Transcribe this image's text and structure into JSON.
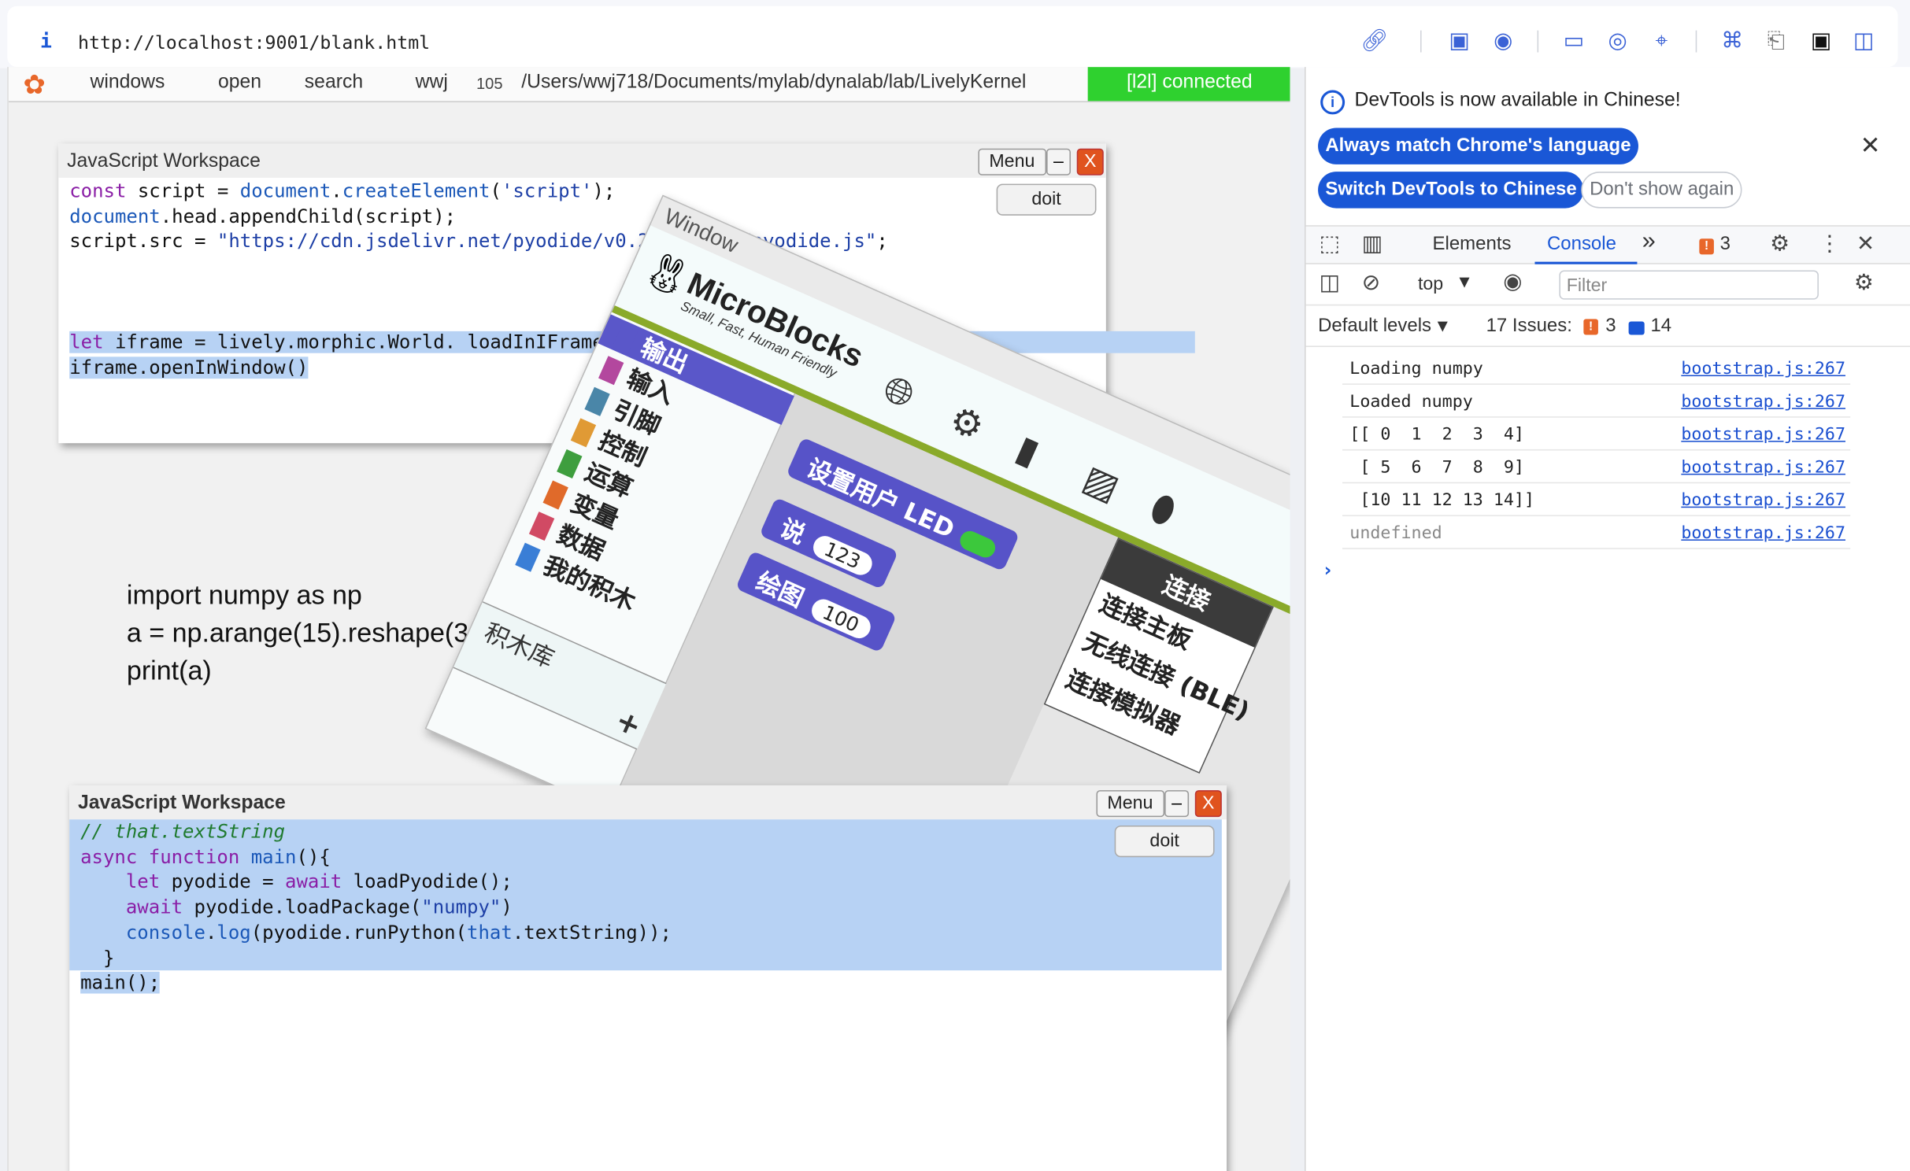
{
  "browser": {
    "info_glyph": "i",
    "url": "http://localhost:9001/blank.html",
    "toolbar_icons": [
      "link-icon",
      "screenshot-icon",
      "camera-icon",
      "terminal-icon",
      "globe-icon",
      "crosshair-icon",
      "extensions-icon",
      "h-icon",
      "square-icon",
      "sidebar-icon"
    ]
  },
  "lively": {
    "menu": [
      "windows",
      "open",
      "search",
      "wwj"
    ],
    "count": "105",
    "path": "/Users/wwj718/Documents/mylab/dynalab/lab/LivelyKernel",
    "status": "[l2l] connected",
    "python_text": "import numpy as np\na = np.arange(15).reshape(3, 5)\nprint(a)"
  },
  "workspace1": {
    "title": "JavaScript Workspace",
    "menu": "Menu",
    "min": "–",
    "close": "X",
    "doit": "doit"
  },
  "workspace2": {
    "title": "JavaScript Workspace",
    "menu": "Menu",
    "min": "–",
    "close": "X",
    "doit": "doit"
  },
  "microblocks": {
    "window_title": "Window",
    "title": "MicroBlocks",
    "subtitle": "Small, Fast, Human Friendly",
    "categories": [
      {
        "label": "输出",
        "color": "#5a57c9"
      },
      {
        "label": "输入",
        "color": "#b3479e"
      },
      {
        "label": "引脚",
        "color": "#4a86a8"
      },
      {
        "label": "控制",
        "color": "#e09a35"
      },
      {
        "label": "运算",
        "color": "#3e9e3e"
      },
      {
        "label": "变量",
        "color": "#e06a2a"
      },
      {
        "label": "数据",
        "color": "#d14a64"
      },
      {
        "label": "我的积木",
        "color": "#3a7ed6"
      }
    ],
    "library": "积木库",
    "add": "+",
    "blocks": {
      "led": "设置用户 LED",
      "say": "说",
      "say_val": "123",
      "graph": "绘图",
      "graph_val": "100"
    },
    "connect": {
      "header": "连接",
      "items": [
        "连接主板",
        "无线连接 (BLE)",
        "连接模拟器"
      ]
    }
  },
  "devtools": {
    "banner": "DevTools is now available in Chinese!",
    "btn_match": "Always match Chrome's language",
    "btn_switch": "Switch DevTools to Chinese",
    "btn_dont": "Don't show again",
    "tab_elements": "Elements",
    "tab_console": "Console",
    "more_tabs": "»",
    "warn_count": "3",
    "context": "top",
    "filter_placeholder": "Filter",
    "levels": "Default levels",
    "issues_label": "17 Issues:",
    "issues_warn": "3",
    "issues_info": "14",
    "logs": [
      {
        "msg": "Loading numpy",
        "src": "bootstrap.js:267"
      },
      {
        "msg": "Loaded numpy",
        "src": "bootstrap.js:267"
      },
      {
        "msg": "[[ 0  1  2  3  4]",
        "src": "bootstrap.js:267"
      },
      {
        "msg": " [ 5  6  7  8  9]",
        "src": "bootstrap.js:267"
      },
      {
        "msg": " [10 11 12 13 14]]",
        "src": "bootstrap.js:267"
      },
      {
        "msg": "undefined",
        "src": "bootstrap.js:267"
      }
    ],
    "prompt": "›"
  }
}
